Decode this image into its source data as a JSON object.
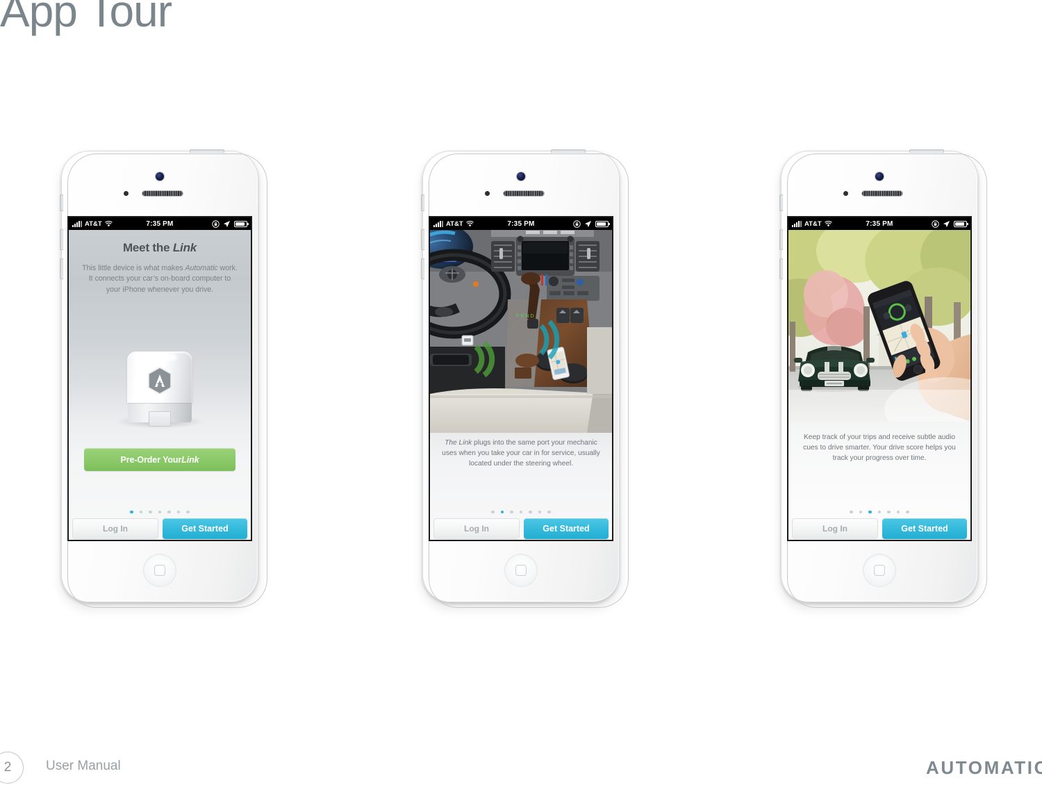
{
  "page": {
    "title": "App Tour",
    "number": "2",
    "doc_label": "User Manual",
    "brand": "AUTOMATIC",
    "accent_teal": "#35b9db",
    "accent_green": "#8cc96a",
    "title_color": "#7b868c"
  },
  "status_bar": {
    "carrier": "AT&T",
    "time": "7:35 PM",
    "signal_icon": "signal-bars-icon",
    "wifi_icon": "wifi-icon",
    "rotation_lock_icon": "rotation-lock-icon",
    "location_icon": "location-arrow-icon",
    "battery_icon": "battery-icon"
  },
  "common": {
    "login_label": "Log In",
    "get_started_label": "Get Started",
    "dot_count": 7
  },
  "phones": [
    {
      "id": "phone-1",
      "screen_type": "link-intro",
      "heading_plain": "Meet the ",
      "heading_italic": "Link",
      "body_pre": "This little device is what makes ",
      "body_italic": "Automatic",
      "body_post": " work. It connects your car’s on-board computer to your iPhone whenever you drive.",
      "cta_pre": "Pre-Order Your ",
      "cta_italic": "Link",
      "device_logo": "automatic-hexagon-a-logo",
      "active_dot": 0
    },
    {
      "id": "phone-2",
      "screen_type": "car-interior-photo",
      "photo_alt": "car-interior-dashboard-photo",
      "caption_italic": "The Link",
      "caption_rest": " plugs into the same port your mechanic uses when you take your car in for service, usually located under the steering wheel.",
      "active_dot": 1
    },
    {
      "id": "phone-3",
      "screen_type": "street-photo",
      "photo_alt": "hand-holding-phone-street-photo",
      "caption": "Keep track of your trips and receive subtle audio cues to drive smarter. Your drive score helps you track your progress over time.",
      "active_dot": 2
    }
  ]
}
